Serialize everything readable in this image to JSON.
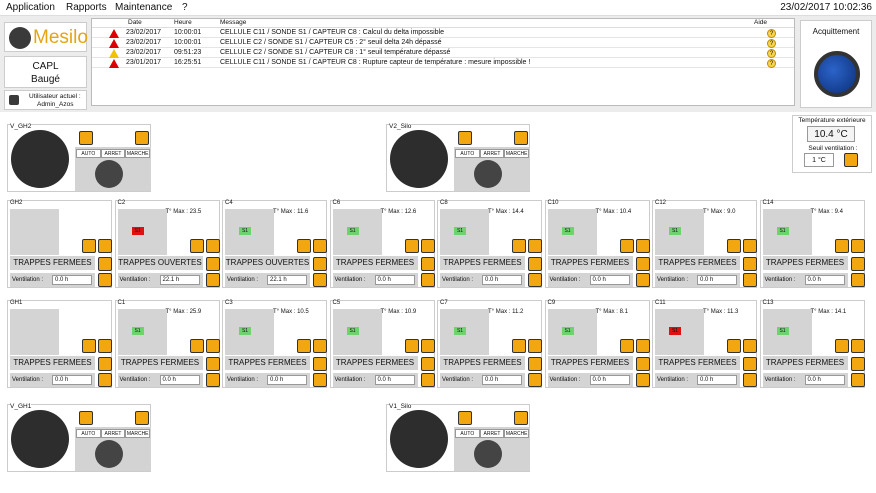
{
  "menu": {
    "items": [
      "Application",
      "Rapports",
      "Maintenance",
      "?"
    ],
    "clock": "23/02/2017 10:02:36"
  },
  "brand": {
    "name": "Mesilo"
  },
  "site": {
    "line1": "CAPL",
    "line2": "Baugé"
  },
  "user": {
    "label": "Utilisateur actuel :",
    "name": "Admin_Azos"
  },
  "alarms": {
    "headers": {
      "date": "Date",
      "time": "Heure",
      "message": "Message",
      "help": "Aide"
    },
    "rows": [
      {
        "date": "23/02/2017",
        "time": "10:00:01",
        "message": "CELLULE C11 / SONDE S1 / CAPTEUR C8 : Calcul du delta impossible",
        "level": "error"
      },
      {
        "date": "23/02/2017",
        "time": "10:00:01",
        "message": "CELLULE C2 / SONDE S1 / CAPTEUR C5 : 2° seuil delta 24h dépassé",
        "level": "error"
      },
      {
        "date": "23/02/2017",
        "time": "09:51:23",
        "message": "CELLULE C2 / SONDE S1 / CAPTEUR C8 : 1° seuil température dépassé",
        "level": "warning"
      },
      {
        "date": "23/01/2017",
        "time": "16:25:51",
        "message": "CELLULE C11 / SONDE S1 / CAPTEUR C8 : Rupture capteur de température : mesure impossible !",
        "level": "error"
      }
    ]
  },
  "ack": {
    "label": "Acquittement"
  },
  "temperature": {
    "label": "Température extérieure",
    "value": "10.4 °C",
    "threshold_label": "Seuil ventilation :",
    "threshold_value": "1 °C"
  },
  "fans": [
    {
      "name": "V_GH2",
      "modes": [
        "AUTO",
        "ARRET",
        "MARCHE"
      ]
    },
    {
      "name": "V2_Silo",
      "modes": [
        "AUTO",
        "ARRET",
        "MARCHE"
      ]
    },
    {
      "name": "V_GH1",
      "modes": [
        "AUTO",
        "ARRET",
        "MARCHE"
      ]
    },
    {
      "name": "V1_Silo",
      "modes": [
        "AUTO",
        "ARRET",
        "MARCHE"
      ]
    }
  ],
  "cells_row1": [
    {
      "name": "GH2",
      "tmax": "",
      "sensor": "",
      "status": "TRAPPES FERMEES",
      "vent_label": "Ventilation :",
      "vent": "0.0 h"
    },
    {
      "name": "C2",
      "tmax": "T° Max : 23.5",
      "sensor": "S1",
      "status": "TRAPPES OUVERTES",
      "vent_label": "Ventilation :",
      "vent": "22.1 h"
    },
    {
      "name": "C4",
      "tmax": "T° Max : 11.6",
      "sensor": "S1",
      "status": "TRAPPES OUVERTES",
      "vent_label": "Ventilation :",
      "vent": "22.1 h"
    },
    {
      "name": "C6",
      "tmax": "T° Max : 12.6",
      "sensor": "S1",
      "status": "TRAPPES FERMEES",
      "vent_label": "Ventilation :",
      "vent": "0.0 h"
    },
    {
      "name": "C8",
      "tmax": "T° Max : 14.4",
      "sensor": "S1",
      "status": "TRAPPES FERMEES",
      "vent_label": "Ventilation :",
      "vent": "0.0 h"
    },
    {
      "name": "C10",
      "tmax": "T° Max : 10.4",
      "sensor": "S1",
      "status": "TRAPPES FERMEES",
      "vent_label": "Ventilation :",
      "vent": "0.0 h"
    },
    {
      "name": "C12",
      "tmax": "T° Max : 9.0",
      "sensor": "S1",
      "status": "TRAPPES FERMEES",
      "vent_label": "Ventilation :",
      "vent": "0.0 h"
    },
    {
      "name": "C14",
      "tmax": "T° Max : 9.4",
      "sensor": "S1",
      "status": "TRAPPES FERMEES",
      "vent_label": "Ventilation :",
      "vent": "0.0 h"
    }
  ],
  "cells_row2": [
    {
      "name": "GH1",
      "tmax": "",
      "sensor": "",
      "status": "TRAPPES FERMEES",
      "vent_label": "Ventilation :",
      "vent": "0.0 h"
    },
    {
      "name": "C1",
      "tmax": "T° Max : 25.9",
      "sensor": "S1",
      "status": "TRAPPES FERMEES",
      "vent_label": "Ventilation :",
      "vent": "0.0 h"
    },
    {
      "name": "C3",
      "tmax": "T° Max : 10.5",
      "sensor": "S1",
      "status": "TRAPPES FERMEES",
      "vent_label": "Ventilation :",
      "vent": "0.0 h"
    },
    {
      "name": "C5",
      "tmax": "T° Max : 10.9",
      "sensor": "S1",
      "status": "TRAPPES FERMEES",
      "vent_label": "Ventilation :",
      "vent": "0.0 h"
    },
    {
      "name": "C7",
      "tmax": "T° Max : 11.2",
      "sensor": "S1",
      "status": "TRAPPES FERMEES",
      "vent_label": "Ventilation :",
      "vent": "0.0 h"
    },
    {
      "name": "C9",
      "tmax": "T° Max : 8.1",
      "sensor": "S1",
      "status": "TRAPPES FERMEES",
      "vent_label": "Ventilation :",
      "vent": "0.0 h"
    },
    {
      "name": "C11",
      "tmax": "T° Max : 11.3",
      "sensor": "S1",
      "status": "TRAPPES FERMEES",
      "vent_label": "Ventilation :",
      "vent": "0.0 h"
    },
    {
      "name": "C13",
      "tmax": "T° Max : 14.1",
      "sensor": "S1",
      "status": "TRAPPES FERMEES",
      "vent_label": "Ventilation :",
      "vent": "0.0 h"
    }
  ],
  "colors": {
    "accent": "#f2a710",
    "sensor_ok": "#6ed36e",
    "sensor_error": "#e01010"
  }
}
